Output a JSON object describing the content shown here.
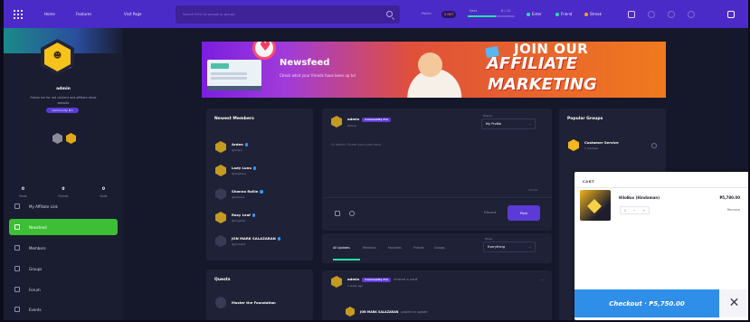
{
  "topbar": {
    "nav": [
      "Home",
      "Features",
      "Visit Page"
    ],
    "search_placeholder": "Search here for people or groups",
    "progress_label": "Points",
    "progress_value": "0 NXT",
    "level_label": "Next",
    "level_value": "8 / 10",
    "stats": [
      {
        "label": "Enter",
        "color": "#27e0a8"
      },
      {
        "label": "Friend",
        "color": "#27e0a8"
      },
      {
        "label": "Streak",
        "color": "#f6a21c"
      }
    ],
    "accent": "#4b2bc7"
  },
  "sidebar": {
    "name": "admin",
    "bio": "Follow me for rad content and affiliate deals",
    "site": "website",
    "role_badge": "Community Pro",
    "stats": [
      {
        "value": "0",
        "label": "Posts"
      },
      {
        "value": "0",
        "label": "Friends"
      },
      {
        "value": "0",
        "label": "Visits"
      }
    ],
    "menu": [
      {
        "label": "My Affiliate Link",
        "active": false
      },
      {
        "label": "Newsfeed",
        "active": true
      },
      {
        "label": "Members",
        "active": false
      },
      {
        "label": "Groups",
        "active": false
      },
      {
        "label": "Forum",
        "active": false
      },
      {
        "label": "Events",
        "active": false
      }
    ]
  },
  "banner": {
    "title": "Newsfeed",
    "subtitle": "Check what your friends have been up to!",
    "promo_1": "JOIN OUR",
    "promo_2": "AFFILIATE",
    "promo_3": "MARKETING"
  },
  "newest_members": {
    "title": "Newest Members",
    "members": [
      {
        "name": "Arden",
        "handle": "@arden"
      },
      {
        "name": "Lady Luna",
        "handle": "@ladyluna"
      },
      {
        "name": "Shonna Rollin",
        "handle": "@shonna"
      },
      {
        "name": "Rosy Leaf",
        "handle": "@rosyleaf"
      },
      {
        "name": "JON MARK SALAZARAN",
        "handle": "@jonmark"
      }
    ]
  },
  "quests": {
    "title": "Quests",
    "item": "Master the Foundation"
  },
  "composer": {
    "author": "admin",
    "tag": "Community Pro",
    "status": "Online",
    "privacy_label": "Post to",
    "privacy_value": "My Profile",
    "placeholder": "Hi admin! Share your post here...",
    "counter": "0/1000",
    "discard": "Discard",
    "post": "Post"
  },
  "feed_tabs": {
    "tabs": [
      "All Updates",
      "Mentions",
      "Favorites",
      "Friends",
      "Groups"
    ],
    "sort_label": "Show",
    "sort_value": "Everything"
  },
  "activity": {
    "author": "admin",
    "tag": "Community Pro",
    "action": "shared a card",
    "time": "1 week ago",
    "sub_author": "JON MARK SALAZARAN",
    "sub_action": "posted an update"
  },
  "popular_groups": {
    "title": "Popular Groups",
    "groups": [
      {
        "name": "Customer Service",
        "meta": "1 member"
      }
    ]
  },
  "cart": {
    "title": "CART",
    "item_name": "HiloBox (Hindaman)",
    "item_price": "₱5,780.00",
    "qty": "1",
    "remove": "Remove",
    "checkout": "Checkout · ₱5,750.00",
    "close": "✕",
    "accent": "#2f8ee8"
  }
}
